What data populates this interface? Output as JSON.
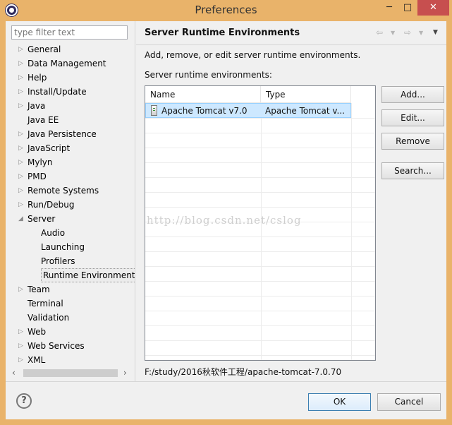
{
  "window": {
    "title": "Preferences",
    "min_glyph": "─",
    "max_glyph": "□",
    "close_glyph": "✕"
  },
  "left": {
    "filter_placeholder": "type filter text",
    "tree": [
      {
        "label": "General",
        "expandable": true,
        "level": 1
      },
      {
        "label": "Data Management",
        "expandable": true,
        "level": 1
      },
      {
        "label": "Help",
        "expandable": true,
        "level": 1
      },
      {
        "label": "Install/Update",
        "expandable": true,
        "level": 1
      },
      {
        "label": "Java",
        "expandable": true,
        "level": 1
      },
      {
        "label": "Java EE",
        "expandable": false,
        "level": 1
      },
      {
        "label": "Java Persistence",
        "expandable": true,
        "level": 1
      },
      {
        "label": "JavaScript",
        "expandable": true,
        "level": 1
      },
      {
        "label": "Mylyn",
        "expandable": true,
        "level": 1
      },
      {
        "label": "PMD",
        "expandable": true,
        "level": 1
      },
      {
        "label": "Remote Systems",
        "expandable": true,
        "level": 1
      },
      {
        "label": "Run/Debug",
        "expandable": true,
        "level": 1
      },
      {
        "label": "Server",
        "expandable": true,
        "expanded": true,
        "level": 1
      },
      {
        "label": "Audio",
        "expandable": false,
        "level": 2
      },
      {
        "label": "Launching",
        "expandable": false,
        "level": 2
      },
      {
        "label": "Profilers",
        "expandable": false,
        "level": 2
      },
      {
        "label": "Runtime Environment",
        "expandable": false,
        "level": 2,
        "selected": true
      },
      {
        "label": "Team",
        "expandable": true,
        "level": 1
      },
      {
        "label": "Terminal",
        "expandable": false,
        "level": 1
      },
      {
        "label": "Validation",
        "expandable": false,
        "level": 1
      },
      {
        "label": "Web",
        "expandable": true,
        "level": 1
      },
      {
        "label": "Web Services",
        "expandable": true,
        "level": 1
      },
      {
        "label": "XML",
        "expandable": true,
        "level": 1
      }
    ]
  },
  "right": {
    "title": "Server Runtime Environments",
    "description": "Add, remove, or edit server runtime environments.",
    "list_label": "Server runtime environments:",
    "columns": [
      "Name",
      "Type"
    ],
    "rows": [
      {
        "name": "Apache Tomcat v7.0",
        "type": "Apache Tomcat v..."
      }
    ],
    "buttons": {
      "add": "Add...",
      "edit": "Edit...",
      "remove": "Remove",
      "search": "Search..."
    },
    "path": "F:/study/2016秋软件工程/apache-tomcat-7.0.70"
  },
  "watermark": "http://blog.csdn.net/cslog",
  "footer": {
    "help": "?",
    "ok": "OK",
    "cancel": "Cancel"
  }
}
